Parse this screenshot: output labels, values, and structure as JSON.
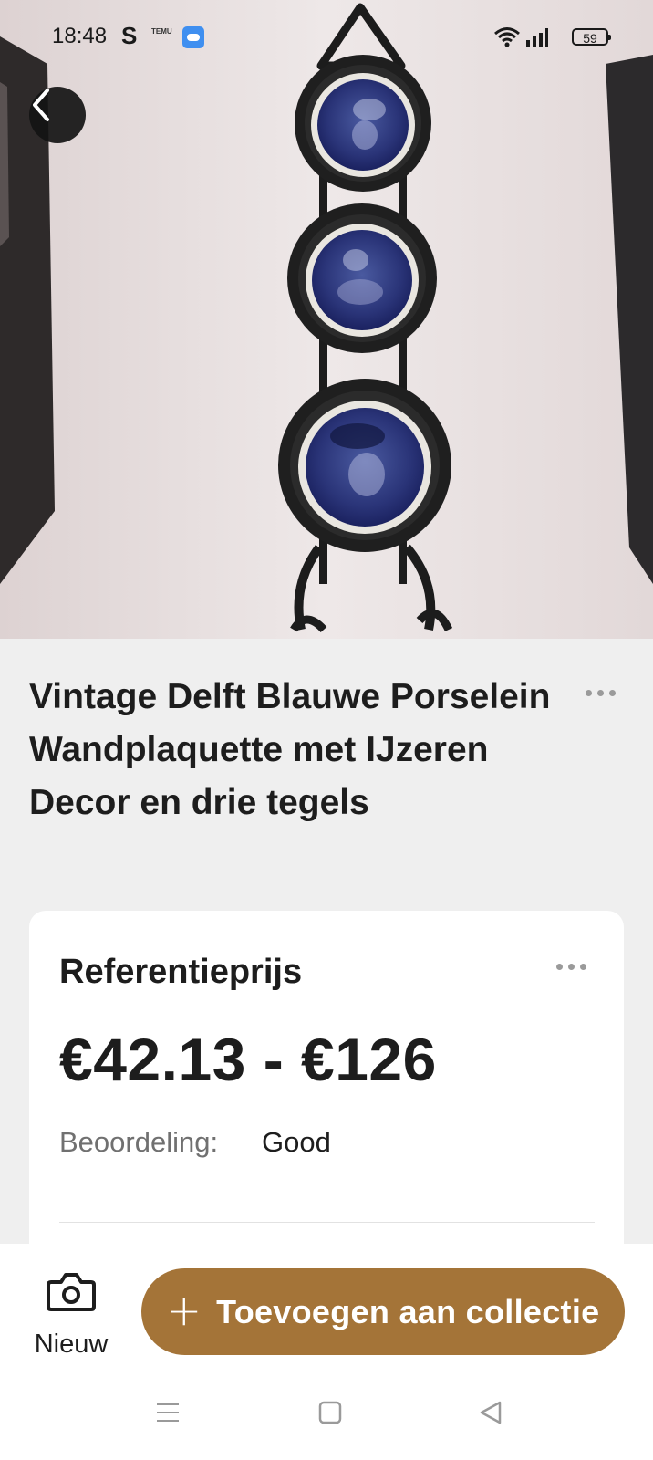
{
  "status_bar": {
    "time": "18:48",
    "app_indicator": "S",
    "temu_badge": "TEMU",
    "battery": "59",
    "icons": [
      "weather-icon",
      "wifi-icon",
      "signal-icon",
      "battery-icon"
    ]
  },
  "hero": {
    "image": "delft-blue-wall-plaque-photo",
    "back_icon": "chevron-left-icon"
  },
  "product": {
    "title": "Vintage Delft Blauwe Porselein Wandplaquette met IJzeren Decor en drie tegels"
  },
  "price_card": {
    "heading": "Referentieprijs",
    "price_range": "€42.13 - €126",
    "rating_label": "Beoordeling:",
    "rating_value": "Good"
  },
  "bottom_bar": {
    "new_label": "Nieuw",
    "add_label": "Toevoegen aan collectie",
    "new_icon": "camera-icon",
    "add_icon": "plus-icon"
  },
  "colors": {
    "accent": "#a47438",
    "background": "#efefef",
    "card": "#ffffff",
    "title": "#1d1d1d",
    "muted": "#707070"
  }
}
